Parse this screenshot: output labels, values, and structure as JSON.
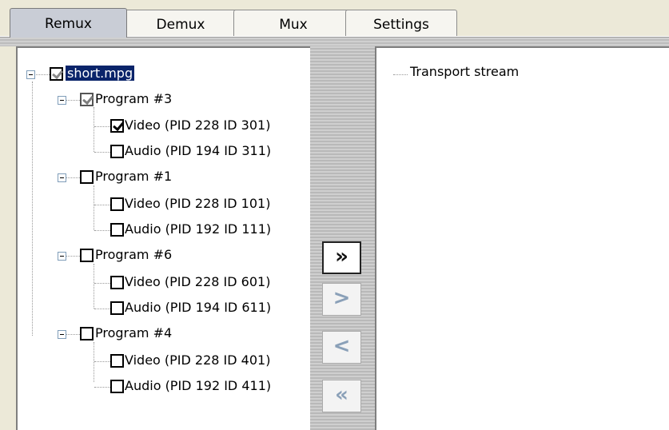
{
  "tabs": [
    {
      "label": "Remux",
      "active": true
    },
    {
      "label": "Demux",
      "active": false
    },
    {
      "label": "Mux",
      "active": false
    },
    {
      "label": "Settings",
      "active": false
    }
  ],
  "tree": {
    "root": {
      "label": "short.mpg",
      "state": "partial"
    },
    "programs": [
      {
        "label": "Program #3",
        "state": "partial",
        "streams": [
          {
            "label": "Video (PID 228 ID 301)",
            "checked": true
          },
          {
            "label": "Audio (PID 194 ID 311)",
            "checked": false
          }
        ]
      },
      {
        "label": "Program #1",
        "state": "unchecked",
        "streams": [
          {
            "label": "Video (PID 228 ID 101)",
            "checked": false
          },
          {
            "label": "Audio (PID 192 ID 111)",
            "checked": false
          }
        ]
      },
      {
        "label": "Program #6",
        "state": "unchecked",
        "streams": [
          {
            "label": "Video (PID 228 ID 601)",
            "checked": false
          },
          {
            "label": "Audio (PID 194 ID 611)",
            "checked": false
          }
        ]
      },
      {
        "label": "Program #4",
        "state": "unchecked",
        "streams": [
          {
            "label": "Video (PID 228 ID 401)",
            "checked": false
          },
          {
            "label": "Audio (PID 192 ID 411)",
            "checked": false
          }
        ]
      }
    ]
  },
  "buttons": {
    "add_all": {
      "glyph": "»",
      "enabled": true
    },
    "add_one": {
      "glyph": ">",
      "enabled": false
    },
    "remove_one": {
      "glyph": "<",
      "enabled": false
    },
    "remove_all": {
      "glyph": "«",
      "enabled": false
    }
  },
  "output": {
    "root_label": "Transport stream"
  }
}
